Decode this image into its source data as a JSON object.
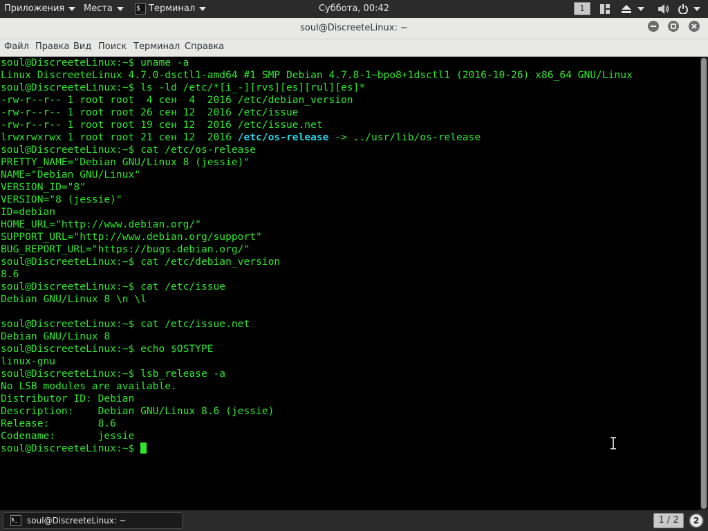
{
  "top_panel": {
    "apps_label": "Приложения",
    "places_label": "Места",
    "terminal_app_label": "Терминал",
    "terminal_icon_glyph": "$_",
    "clock": "Суббота, 00:42",
    "workspace": "1",
    "icons": [
      "windows-icon",
      "eject-icon",
      "volume-icon",
      "power-icon"
    ]
  },
  "window": {
    "title": "soul@DiscreeteLinux: ~",
    "buttons": [
      "minimize",
      "maximize",
      "close"
    ]
  },
  "menubar": {
    "items": [
      "Файл",
      "Правка",
      "Вид",
      "Поиск",
      "Терминал",
      "Справка"
    ]
  },
  "terminal": {
    "lines": [
      "soul@DiscreeteLinux:~$ uname -a",
      "Linux DiscreeteLinux 4.7.0-dsctl1-amd64 #1 SMP Debian 4.7.8-1~bpo8+1dsctl1 (2016-10-26) x86_64 GNU/Linux",
      "soul@DiscreeteLinux:~$ ls -ld /etc/*[i_-][rvs][es][rul][es]*",
      "-rw-r--r-- 1 root root  4 сен  4  2016 /etc/debian_version",
      "-rw-r--r-- 1 root root 26 сен 12  2016 /etc/issue",
      "-rw-r--r-- 1 root root 19 сен 12  2016 /etc/issue.net",
      "lrwxrwxrwx 1 root root 21 сен 12  2016 ",
      "soul@DiscreeteLinux:~$ cat /etc/os-release",
      "PRETTY_NAME=\"Debian GNU/Linux 8 (jessie)\"",
      "NAME=\"Debian GNU/Linux\"",
      "VERSION_ID=\"8\"",
      "VERSION=\"8 (jessie)\"",
      "ID=debian",
      "HOME_URL=\"http://www.debian.org/\"",
      "SUPPORT_URL=\"http://www.debian.org/support\"",
      "BUG_REPORT_URL=\"https://bugs.debian.org/\"",
      "soul@DiscreeteLinux:~$ cat /etc/debian_version",
      "8.6",
      "soul@DiscreeteLinux:~$ cat /etc/issue",
      "Debian GNU/Linux 8 \\n \\l",
      "",
      "soul@DiscreeteLinux:~$ cat /etc/issue.net",
      "Debian GNU/Linux 8",
      "soul@DiscreeteLinux:~$ echo $OSTYPE",
      "linux-gnu",
      "soul@DiscreeteLinux:~$ lsb_release -a",
      "No LSB modules are available.",
      "Distributor ID:\tDebian",
      "Description:\tDebian GNU/Linux 8.6 (jessie)",
      "Release:\t8.6",
      "Codename:\tjessie",
      "soul@DiscreeteLinux:~$ "
    ],
    "symlink_name": "/etc/os-release",
    "symlink_target": " -> ../usr/lib/os-release",
    "symlink_line_index": 6,
    "colors": {
      "text": "#2fe62f",
      "link": "#27d3e8",
      "background": "#000000"
    }
  },
  "bottom_panel": {
    "taskbar_title": "soul@DiscreeteLinux: ~",
    "page_indicator": "1 / 2",
    "notifications": "2"
  }
}
